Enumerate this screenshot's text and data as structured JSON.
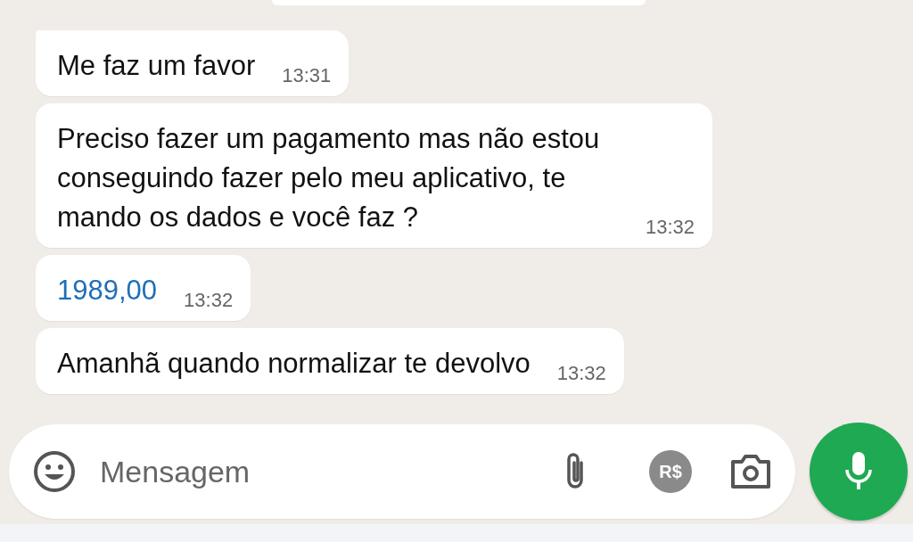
{
  "messages": [
    {
      "kind": "text",
      "text": "Me faz um favor",
      "time": "13:31"
    },
    {
      "kind": "text",
      "text": "Preciso fazer um pagamento mas não estou conseguindo fazer pelo meu aplicativo, te mando os dados e você faz ?",
      "time": "13:32"
    },
    {
      "kind": "link",
      "text": "1989,00",
      "time": "13:32"
    },
    {
      "kind": "text",
      "text": "Amanhã quando normalizar te devolvo",
      "time": "13:32"
    }
  ],
  "composer": {
    "placeholder": "Mensagem",
    "payment_label": "R$"
  }
}
